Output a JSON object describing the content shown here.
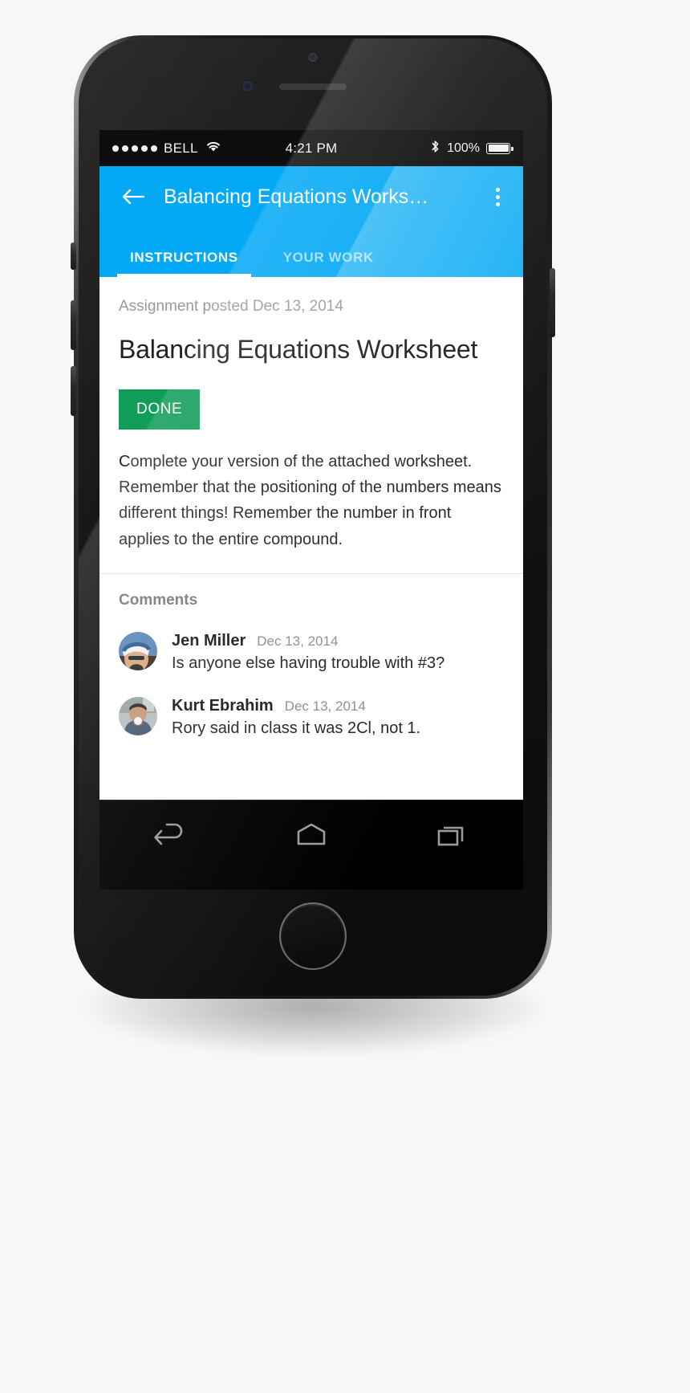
{
  "status_bar": {
    "signal_dots": 5,
    "carrier": "BELL",
    "wifi_icon": "wifi-icon",
    "time": "4:21 PM",
    "bluetooth_icon": "bluetooth-icon",
    "battery_percent": "100%"
  },
  "app_bar": {
    "back_icon": "back-arrow-icon",
    "title": "Balancing Equations Works…",
    "overflow_icon": "overflow-menu-icon",
    "accent_color": "#03A9F4",
    "tabs": [
      {
        "label": "INSTRUCTIONS",
        "active": true
      },
      {
        "label": "YOUR WORK",
        "active": false
      }
    ]
  },
  "assignment": {
    "posted": "Assignment posted Dec 13, 2014",
    "title": "Balancing Equations Worksheet",
    "status_label": "DONE",
    "status_color": "#0F9D58",
    "description": "Complete your version of the attached worksheet. Remember that the positioning of the numbers means different things! Remember the number in front applies to the entire compound."
  },
  "comments": {
    "heading": "Comments",
    "items": [
      {
        "author": "Jen Miller",
        "date": "Dec 13, 2014",
        "text": "Is anyone else having trouble with #3?"
      },
      {
        "author": "Kurt Ebrahim",
        "date": "Dec 13, 2014",
        "text": "Rory said in class it was 2Cl, not 1."
      }
    ]
  },
  "nav_bar": {
    "back": "android-back-icon",
    "home": "android-home-icon",
    "recents": "android-recents-icon"
  }
}
